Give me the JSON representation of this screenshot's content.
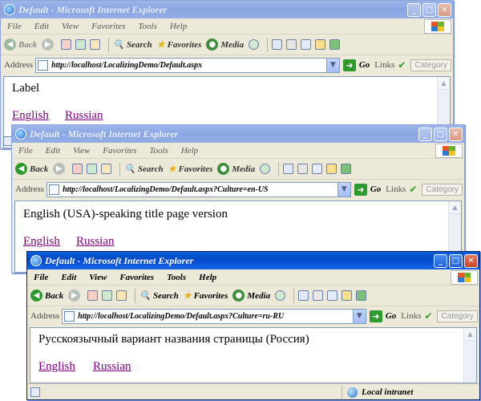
{
  "windows": [
    {
      "title": "Default - Microsoft Internet Explorer",
      "menu": [
        "File",
        "Edit",
        "View",
        "Favorites",
        "Tools",
        "Help"
      ],
      "toolbar": {
        "back": "Back",
        "search": "Search",
        "favorites": "Favorites",
        "media": "Media"
      },
      "address_label": "Address",
      "url": "http://localhost/LocalizingDemo/Default.aspx",
      "go": "Go",
      "links": "Links",
      "category": "Category",
      "page_text": "Label",
      "link_english": "English",
      "link_russian": "Russian"
    },
    {
      "title": "Default - Microsoft Internet Explorer",
      "menu": [
        "File",
        "Edit",
        "View",
        "Favorites",
        "Tools",
        "Help"
      ],
      "toolbar": {
        "back": "Back",
        "search": "Search",
        "favorites": "Favorites",
        "media": "Media"
      },
      "address_label": "Address",
      "url": "http://localhost/LocalizingDemo/Default.aspx?Culture=en-US",
      "go": "Go",
      "links": "Links",
      "category": "Category",
      "page_text": "English (USA)-speaking title page version",
      "link_english": "English",
      "link_russian": "Russian"
    },
    {
      "title": "Default - Microsoft Internet Explorer",
      "menu": [
        "File",
        "Edit",
        "View",
        "Favorites",
        "Tools",
        "Help"
      ],
      "toolbar": {
        "back": "Back",
        "search": "Search",
        "favorites": "Favorites",
        "media": "Media"
      },
      "address_label": "Address",
      "url": "http://localhost/LocalizingDemo/Default.aspx?Culture=ru-RU",
      "go": "Go",
      "links": "Links",
      "category": "Category",
      "page_text": "Русскоязычный вариант названия страницы (Россия)",
      "link_english": "English",
      "link_russian": "Russian",
      "status_zone": "Local intranet"
    }
  ],
  "colors": {
    "titlebar_active": "#0a5fd8",
    "titlebar_inactive": "#9db6ea",
    "visited_link": "#800080",
    "chrome": "#ece9d8"
  }
}
